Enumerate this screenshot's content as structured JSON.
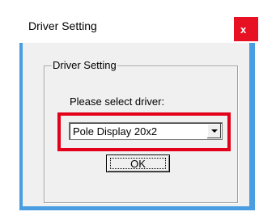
{
  "window": {
    "title": "Driver Setting",
    "close_label": "x",
    "close_color": "#e81123",
    "border_color": "#4a9de0"
  },
  "group": {
    "label": "Driver Setting"
  },
  "form": {
    "prompt": "Please select driver:",
    "driver_select": {
      "selected": "Pole Display 20x2",
      "dropdown_icon": "chevron-down-icon"
    },
    "ok_label": "OK"
  },
  "annotation": {
    "highlight_color": "#e2001a"
  }
}
